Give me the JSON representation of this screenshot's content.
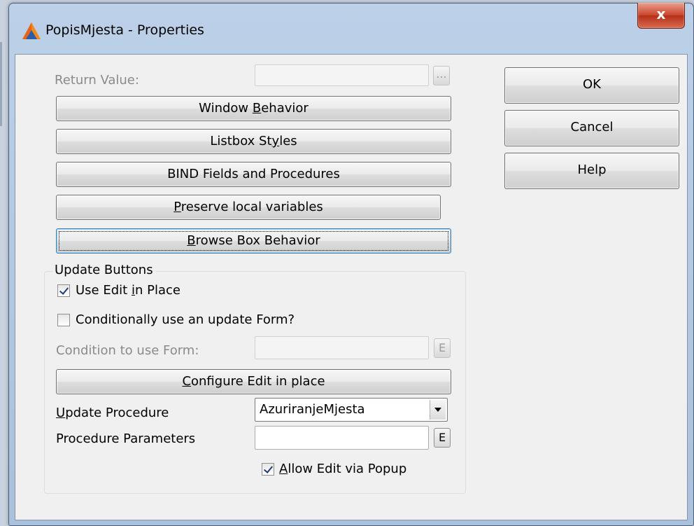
{
  "window": {
    "title": "PopisMjesta - Properties",
    "close_label": "x"
  },
  "return_value": {
    "label": "Return Value:",
    "value": "",
    "ellipsis_label": "..."
  },
  "buttons": {
    "window_behavior": {
      "pre": "Window ",
      "key": "B",
      "post": "ehavior"
    },
    "listbox_styles": {
      "pre": "Listbox St",
      "key": "y",
      "post": "les"
    },
    "bind_fields": {
      "pre": "BIND Fields and Procedures",
      "key": "",
      "post": ""
    },
    "preserve_local": {
      "pre": "",
      "key": "P",
      "post": "reserve local variables"
    },
    "browse_box": {
      "pre": "",
      "key": "B",
      "post": "rowse Box Behavior"
    },
    "configure_edit": {
      "pre": "",
      "key": "C",
      "post": "onfigure Edit in place"
    }
  },
  "dialog_buttons": {
    "ok": "OK",
    "cancel": "Cancel",
    "help": "Help"
  },
  "update_buttons": {
    "group_title": "Update Buttons",
    "use_edit_in_place": {
      "pre": "Use Edit ",
      "key": "i",
      "post": "n Place",
      "checked": true
    },
    "conditional_form": {
      "label": "Conditionally use an update Form?",
      "checked": false
    },
    "condition_label": "Condition to use Form:",
    "condition_value": "",
    "e_label": "E",
    "update_procedure": {
      "key": "U",
      "post": "pdate Procedure",
      "value": "AzuriranjeMjesta"
    },
    "procedure_parameters": {
      "label": "Procedure Parameters",
      "value": ""
    },
    "allow_edit_popup": {
      "key": "A",
      "post": "llow Edit via Popup",
      "checked": true
    }
  }
}
